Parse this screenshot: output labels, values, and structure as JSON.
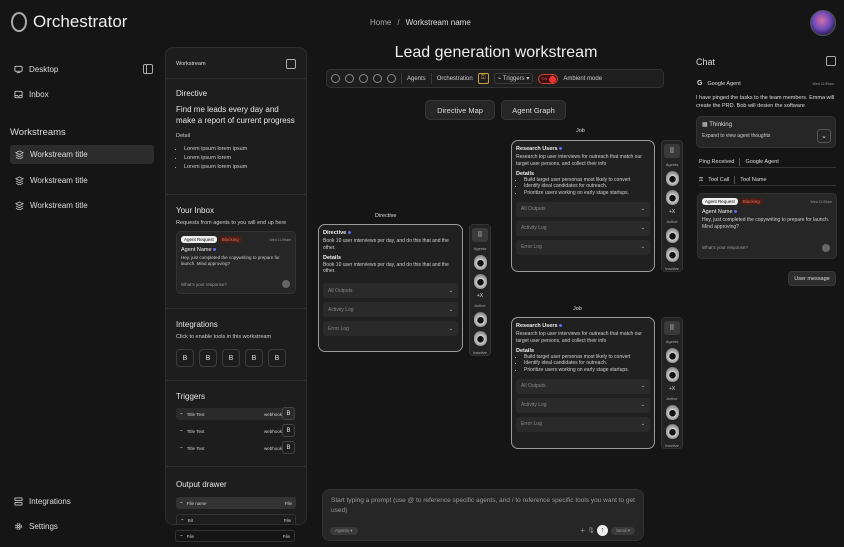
{
  "app": {
    "name": "Orchestrator"
  },
  "breadcrumb": {
    "home": "Home",
    "separator": "/",
    "current": "Workstream name"
  },
  "sidebar": {
    "top_items": [
      {
        "label": "Desktop",
        "icon": "desktop-icon"
      },
      {
        "label": "Inbox",
        "icon": "inbox-icon"
      }
    ],
    "workstreams_heading": "Workstreams",
    "workstreams": [
      "Workstream title",
      "Workstream title",
      "Workstream title"
    ],
    "bottom_items": [
      {
        "label": "Integrations",
        "icon": "integrations-icon"
      },
      {
        "label": "Settings",
        "icon": "gear-icon"
      }
    ]
  },
  "ws_panel": {
    "header": "Workstream",
    "directive_title": "Directive",
    "directive_text": "Find me leads every day and make a report of current progress",
    "detail_label": "Detail",
    "details": [
      "Lorem ipsum lorem ipsum",
      "Lorem ipsum lorem",
      "Lorem ipsum lorem ipsum"
    ],
    "inbox_title": "Your Inbox",
    "inbox_sub": "Requests from agents to you will end up here",
    "inbox_card": {
      "tag": "Agent Request",
      "status": "Blocking",
      "time": "Wed 11:59am",
      "agent": "Agent Name",
      "message": "Hey, just completed the copywriting to prepare for launch. Mind approving?",
      "placeholder": "What's your response?"
    },
    "integrations_title": "Integrations",
    "integrations_sub": "Click to enable tools in this workstream",
    "integration_buttons": [
      "B",
      "B",
      "B",
      "B",
      "B"
    ],
    "triggers_title": "Triggers",
    "triggers": [
      {
        "name": "Title Text",
        "type": "webhook",
        "btn": "B"
      },
      {
        "name": "Title Text",
        "type": "webhook",
        "btn": "B"
      },
      {
        "name": "Title Text",
        "type": "webhook",
        "btn": "B"
      }
    ],
    "output_title": "Output drawer",
    "outputs": [
      {
        "name": "File name",
        "type": "File"
      },
      {
        "name": "Bit",
        "type": "File"
      },
      {
        "name": "File",
        "type": "File"
      }
    ]
  },
  "main": {
    "title": "Lead generation workstream",
    "toolbar": {
      "agents": "Agents",
      "orchestration": "Orchestration",
      "triggers": "Triggers",
      "toggle": "ON",
      "ambient": "Ambient mode"
    },
    "view_buttons": [
      "Directive Map",
      "Agent Graph"
    ],
    "directive_node": {
      "label": "Directive",
      "title": "Directive",
      "text": "Book 10 user interviews per day, and do this that and the other.",
      "details_label": "Details",
      "details_text": "Book 10 user interviews per day, and do this that and the other.",
      "fields": [
        "All Outputs",
        "Activity Log",
        "Error Log"
      ]
    },
    "job_nodes": [
      {
        "label": "Job",
        "title": "Research Users",
        "text": "Research top user interviews for outreach that match our target user persons, and collect their info",
        "details_label": "Details",
        "details": [
          "Build target user personas most likely to convert",
          "Identify ideal candidates for outreach.",
          "Prioritize users working on early stage startups."
        ],
        "fields": [
          "All Outputs",
          "Activity Log",
          "Error Log"
        ]
      },
      {
        "label": "Job",
        "title": "Research Users",
        "text": "Research top user interviews for outreach that match our target user persons, and collect their info",
        "details_label": "Details",
        "details": [
          "Build target user personas most likely to convert",
          "Identify ideal candidates for outreach.",
          "Prioritize users working on early stage startups."
        ],
        "fields": [
          "All Outputs",
          "Activity Log",
          "Error Log"
        ]
      }
    ],
    "agent_strip": {
      "label": "Agents",
      "more": "+X",
      "active": "Active",
      "inactive": "Inactive"
    },
    "prompt": {
      "placeholder": "Start typing a prompt (use @ to reference specific agents, and / to reference specific tools you want to get used)",
      "left_chip": "Agents",
      "right_chip": "Send"
    }
  },
  "chat": {
    "title": "Chat",
    "agent_name": "Google Agent",
    "time": "Wed 11:59am",
    "message": "I have pinged the tasks to the team members. Emma will create the PRD. Bob will desien the software",
    "thinking_title": "Thinking",
    "thinking_sub": "Expand to view agent thoughts",
    "ping_label": "Ping Received",
    "ping_agent": "Google Agent",
    "tool_label": "Tool Call",
    "tool_name": "Tool Name",
    "request": {
      "tag": "Agent Request",
      "status": "Blocking",
      "time": "Wed 11:59am",
      "agent": "Agent Name",
      "message": "Hey, just completed the copywriting to prepare for launch. Mind approving?",
      "placeholder": "What's your response?"
    },
    "user_message": "User message"
  },
  "colors": {
    "background": "#151515",
    "panel": "#1d1d1d",
    "accent_blue": "#5a6cf0",
    "blocking": "#c0442f",
    "toggle_red": "#e33333"
  }
}
